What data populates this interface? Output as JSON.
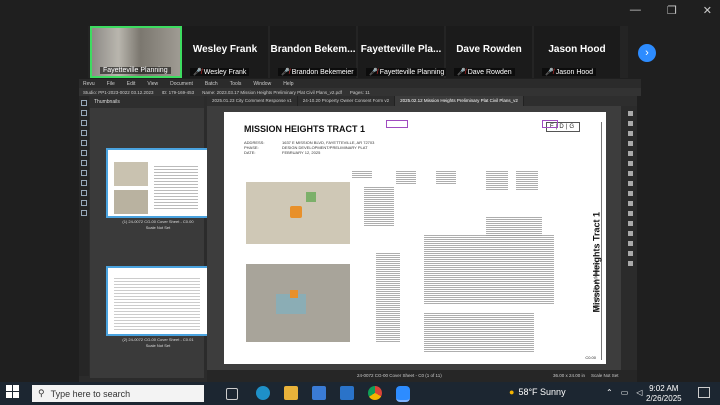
{
  "participants": [
    {
      "big": "",
      "small": "Fayetteville Planning",
      "active": true
    },
    {
      "big": "Wesley Frank",
      "small": "Wesley Frank"
    },
    {
      "big": "Brandon  Bekem...",
      "small": "Brandon Bekemeier"
    },
    {
      "big": "Fayetteville  Pla...",
      "small": "Fayetteville Planning"
    },
    {
      "big": "Dave Rowden",
      "small": "Dave Rowden"
    },
    {
      "big": "Jason Hood",
      "small": "Jason Hood"
    }
  ],
  "app": {
    "menu": [
      "Revu",
      "File",
      "Edit",
      "View",
      "Document",
      "Batch",
      "Tools",
      "Window",
      "Help"
    ],
    "infobar": [
      "Studio: PP1-2023-0022 03.12.2023",
      "ID: 179-169-453",
      "Name: 2023.03.17 Mission Heights Preliminary Plat Civil Plans_v2.pdf",
      "Pages: 11"
    ],
    "thumb_header": "Thumbnails",
    "thumb_captions": [
      "(1) 24-0072 CG-00 Cover Sheet - C0.00",
      "(2) 24-0072 CG-00 Cover Sheet - C0.01"
    ],
    "thumb_sub": "Scale Not Set",
    "tabs": [
      "2025.01.23 City Comment Response v1",
      "24-10.20 Property Owner Consent Form v2",
      "2025.02.12 Mission Heights Preliminary Plat Civil Plans_v2"
    ],
    "status": {
      "page": "24-0072 CG-00 Cover Sheet - C0 (1 of 11)",
      "size": "36.00 x 24.00 in",
      "scale": "Scale Not Set"
    }
  },
  "sheet": {
    "title": "MISSION HEIGHTS TRACT 1",
    "address_label": "ADDRESS:",
    "address": "1637 E MISSION BLVD, FAYETTEVILLE, AR 72703",
    "phase_label": "PHASE:",
    "phase": "DESIGN DEVELOPMENT/PRELIMINARY PLAT",
    "date_label": "DATE:",
    "date": "FEBRUARY 12, 2025",
    "logo": "E|D|G",
    "vertical_title": "Mission Heights Tract 1",
    "vertical_sub": "Fayetteville, Arkansas",
    "sheet_no": "C0.00"
  },
  "taskbar": {
    "search_placeholder": "Type here to search",
    "weather": "58°F  Sunny",
    "time": "9:02 AM",
    "date": "2/26/2025"
  },
  "colors": {
    "accent": "#2d8cff",
    "active_speaker": "#3ddc60",
    "mic_muted": "#e33b3b"
  }
}
